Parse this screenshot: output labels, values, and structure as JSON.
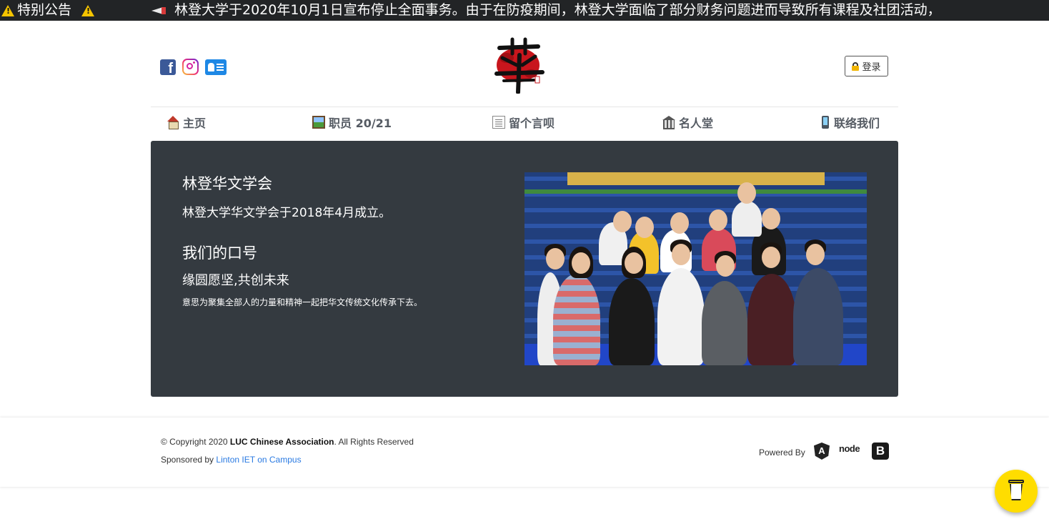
{
  "announcement": {
    "label": "特别公告",
    "message": "林登大学于2020年10月1日宣布停止全面事务。由于在防疫期间，林登大学面临了部分财务问题进而导致所有课程及社团活动，"
  },
  "header": {
    "login_label": "登录"
  },
  "nav": {
    "items": [
      {
        "label": "主页",
        "icon": "home-icon"
      },
      {
        "label": "职员 20/21",
        "icon": "photo-icon"
      },
      {
        "label": "留个言呗",
        "icon": "memo-icon"
      },
      {
        "label": "名人堂",
        "icon": "classical-building-icon"
      },
      {
        "label": "联络我们",
        "icon": "mobile-phone-icon"
      }
    ]
  },
  "hero": {
    "title": "林登华文学会",
    "intro": "林登大学华文学会于2018年4月成立。",
    "motto_heading": "我们的口号",
    "motto": "缘圆愿坚,共创未来",
    "motto_desc": "意思为聚集全部人的力量和精神一起把华文传统文化传承下去。"
  },
  "footer": {
    "copyright_prefix": "© Copyright 2020 ",
    "org_name": "LUC Chinese Association",
    "copyright_suffix": ". All Rights Reserved",
    "sponsored_prefix": "Sponsored by ",
    "sponsor_link": "Linton IET on Campus",
    "powered_by": "Powered By",
    "angular_glyph": "A",
    "node_text": "node",
    "bootstrap_glyph": "B"
  },
  "colors": {
    "announce_bg": "#222426",
    "hero_bg": "#343a40",
    "nav_text": "#555b63",
    "link": "#2a7ae2",
    "coffee_button": "#ffdd00"
  }
}
